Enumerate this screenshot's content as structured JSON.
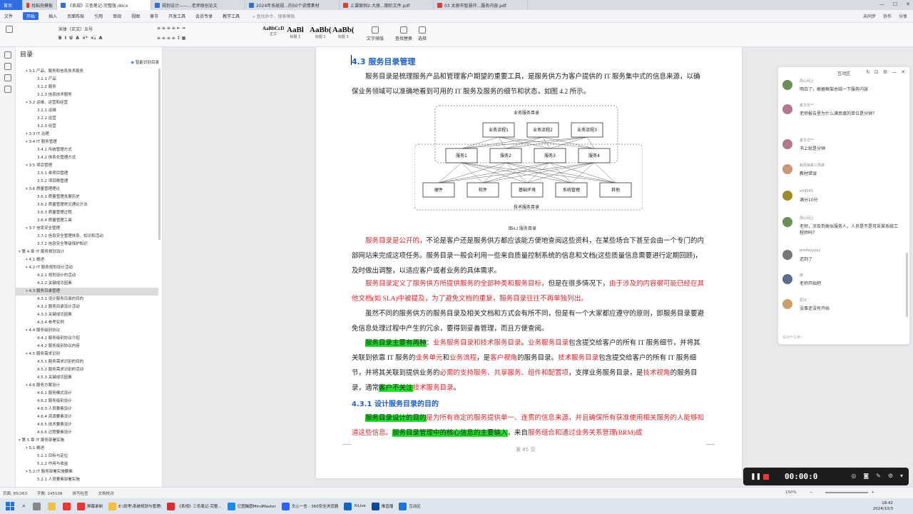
{
  "tabs": [
    {
      "label": "首页",
      "type": "home"
    },
    {
      "label": "找稻壳模板",
      "color": "#e53935"
    },
    {
      "label": "《系规》三色笔记-完整版.docx",
      "color": "#2f6fe0",
      "active": true
    },
    {
      "label": "规划设计——...老师原创论文",
      "color": "#2f6fe0"
    },
    {
      "label": "2024年系统规...的50个说情素材",
      "color": "#2f6fe0"
    },
    {
      "label": "上课案例2-大原...期阶文件.pdf",
      "color": "#e53935"
    },
    {
      "label": "03 太原市智慧环...服务内容.pdf",
      "color": "#e53935"
    }
  ],
  "menu": {
    "items": [
      "文件",
      "开始",
      "插入",
      "页面布局",
      "引用",
      "审阅",
      "视图",
      "章节",
      "开发工具",
      "会员专享",
      "教学工具"
    ],
    "active": "开始",
    "search_placeholder": "查找命令、搜索模板",
    "right": [
      "未同步",
      "协作",
      "分享"
    ]
  },
  "ribbon": {
    "font_name": "宋体（正文）",
    "font_size": "五号",
    "styles": [
      {
        "preview": "AaBbCcD",
        "label": "正文"
      },
      {
        "preview": "AaBl",
        "label": "标题 1"
      },
      {
        "preview": "AaBb(",
        "label": "标题 2"
      },
      {
        "preview": "AaBb(",
        "label": "标题 3"
      }
    ],
    "buttons": [
      "文字排版",
      "查找替换",
      "选择"
    ]
  },
  "toc": {
    "title": "目录",
    "smart_label": "智能识别目录",
    "selected_index": 32,
    "items": [
      {
        "text": "3.1 产品、服务和信息技术服务",
        "level": 1
      },
      {
        "text": "3.1.1 产品",
        "level": 2
      },
      {
        "text": "3.1.2 服务",
        "level": 2
      },
      {
        "text": "3.1.3 信息技术服务",
        "level": 2
      },
      {
        "text": "3.2 运维、运营和经营",
        "level": 1
      },
      {
        "text": "3.2.1 运维",
        "level": 2
      },
      {
        "text": "3.2.2 运营",
        "level": 2
      },
      {
        "text": "3.2.3 经营",
        "level": 2
      },
      {
        "text": "3.3 IT 治理",
        "level": 1
      },
      {
        "text": "3.4 IT 服务管理",
        "level": 1
      },
      {
        "text": "3.4.1 传统管理方式",
        "level": 2
      },
      {
        "text": "3.4.2 体系化管理方式",
        "level": 2
      },
      {
        "text": "3.5 项目管理",
        "level": 1
      },
      {
        "text": "3.5.1 单项目管理",
        "level": 2
      },
      {
        "text": "3.5.2 项目群管理",
        "level": 2
      },
      {
        "text": "3.6 质量管理理论",
        "level": 1
      },
      {
        "text": "3.6.1 质量管理发展历史",
        "level": 2
      },
      {
        "text": "3.6.2 质量管理常见理论方法",
        "level": 2
      },
      {
        "text": "3.6.3 质量管理过程",
        "level": 2
      },
      {
        "text": "3.6.4 质量管理工具",
        "level": 2
      },
      {
        "text": "3.7 信息安全管理",
        "level": 1
      },
      {
        "text": "3.7.1 信息安全管理体系、知识和活动",
        "level": 2
      },
      {
        "text": "3.7.2 信息安全等级保护知识",
        "level": 2
      },
      {
        "text": "第 4 章 IT 服务规划设计",
        "level": 0
      },
      {
        "text": "4.1 概述",
        "level": 1
      },
      {
        "text": "4.2 IT 服务规划设计活动",
        "level": 1
      },
      {
        "text": "4.2.1 规划设计的活动",
        "level": 2
      },
      {
        "text": "4.2.2 关键成功因素",
        "level": 2
      },
      {
        "text": "4.3 服务目录管理",
        "level": 1
      },
      {
        "text": "4.3.1 设计服务目录的目的",
        "level": 2
      },
      {
        "text": "4.3.2 服务目录设计活动",
        "level": 2
      },
      {
        "text": "4.3.3 关键成功因素",
        "level": 2
      },
      {
        "text": "4.3.4 参考实例",
        "level": 2
      },
      {
        "text": "4.4 服务级别协议",
        "level": 1
      },
      {
        "text": "4.4.1 服务级别协议介绍",
        "level": 2
      },
      {
        "text": "4.4.2 服务级别协议内容",
        "level": 2
      },
      {
        "text": "4.5 服务需求识别",
        "level": 1
      },
      {
        "text": "4.5.1 服务需求识别的目的",
        "level": 2
      },
      {
        "text": "4.5.2 服务需求识别的活动",
        "level": 2
      },
      {
        "text": "4.5.3 关键成功因素",
        "level": 2
      },
      {
        "text": "4.6 服务方案设计",
        "level": 1
      },
      {
        "text": "4.6.1 服务模式设计",
        "level": 2
      },
      {
        "text": "4.6.2 服务级别设计",
        "level": 2
      },
      {
        "text": "4.6.3 人员要素设计",
        "level": 2
      },
      {
        "text": "4.6.4 资源要素设计",
        "level": 2
      },
      {
        "text": "4.6.5 技术要素设计",
        "level": 2
      },
      {
        "text": "4.6.6 过程要素设计",
        "level": 2
      },
      {
        "text": "第 5 章 IT 服务部署实施",
        "level": 0
      },
      {
        "text": "5.1 概述",
        "level": 1
      },
      {
        "text": "5.1.1 目标与定位",
        "level": 2
      },
      {
        "text": "5.1.2 作用与收益",
        "level": 2
      },
      {
        "text": "5.2 IT 服务部署实施要素",
        "level": 1
      },
      {
        "text": "5.2.1 人员要素部署实施",
        "level": 2
      }
    ]
  },
  "document": {
    "heading": "4.3  服务目录管理",
    "para1": "服务目录是梳理服务产品和管理客户期望的重要工具，是服务供方为客户提供的 IT 服务集中式的信息来源，以确保业务领域可以准确地看到可用的 IT 服务及服务的细节和状态，如图 4.2 所示。",
    "diagram": {
      "top_label": "业务服务目录",
      "bottom_label": "技术服务目录",
      "processes": [
        "业务流程1",
        "业务流程2",
        "业务流程3"
      ],
      "services": [
        "服务1",
        "服务2",
        "服务3",
        "服务4"
      ],
      "components": [
        "硬件",
        "软件",
        "基础环境",
        "系统管理",
        "其他"
      ]
    },
    "figure_caption": "图4.2   服务目录",
    "para2_red": "服务目录是公开的，",
    "para2": "不论是客户还是服务供方都应该能方便地查阅这些资料，在某些场合下甚至会由一个专门的内部网站来完成这项任务。服务目录一般会利用一些来自质量控制系统的信息和文档(这些质量信息需要进行定期回顾)，及时做出调整，以适应客户或者业务的具体需求。",
    "para3_a": "服务目录定义了服务供方所提供服务的全部种类和服务目标，",
    "para3_b": "但是在很多情况下，",
    "para3_c": "由于涉及的内容很可能已经在其他文档(如 SLA)中被提及，为了避免文档的重复，服务目录往往不再单独列出。",
    "para4": "虽然不同的服务供方的服务目录及相关文档和方式会有所不同，但是有一个大家都应遵守的原则，即服务目录要避免信息处理过程中产生的冗余，要得到妥善管理，而且方便查阅。",
    "para5": [
      {
        "t": "服务目录主要有两种",
        "s": "hl"
      },
      {
        "t": "：",
        "s": ""
      },
      {
        "t": "业务服务目录和技术服务目录",
        "s": "red"
      },
      {
        "t": "。",
        "s": ""
      },
      {
        "t": "业务服务目录",
        "s": "red"
      },
      {
        "t": "包含提交给客户的所有 IT 服务细节，并将其关联到依靠 IT 服务的",
        "s": ""
      },
      {
        "t": "业务单元",
        "s": "red"
      },
      {
        "t": "和",
        "s": ""
      },
      {
        "t": "业务流程",
        "s": "red"
      },
      {
        "t": "，是",
        "s": ""
      },
      {
        "t": "客户视角",
        "s": "red"
      },
      {
        "t": "的服务目录。",
        "s": ""
      },
      {
        "t": "技术服务目录",
        "s": "red"
      },
      {
        "t": "包含提交给客户的所有 IT 服务细节，并将其关联到提供业务的",
        "s": ""
      },
      {
        "t": "必需的支持服务、共享服务、组件和配置项",
        "s": "red"
      },
      {
        "t": "，支撑业务服务目录，是",
        "s": ""
      },
      {
        "t": "技术视角",
        "s": "red"
      },
      {
        "t": "的服务目录，通常",
        "s": ""
      },
      {
        "t": "客户不关注",
        "s": "hl"
      },
      {
        "t": "技术服务目录",
        "s": "red"
      },
      {
        "t": "。",
        "s": ""
      }
    ],
    "subheading": "4.3.1  设计服务目录的目的",
    "para6": [
      {
        "t": "服务目录设计的目的",
        "s": "hl"
      },
      {
        "t": "是为所有商定的服务提供单一、连贯的信息来源，并且确保所有获准使用相关服务的人能够知道这些信息。",
        "s": "red"
      },
      {
        "t": "服务目录管理中的核心信息的主要输入",
        "s": "hl"
      },
      {
        "t": "，来自",
        "s": ""
      },
      {
        "t": "服务组合和通过业务关系管理(BRM)或",
        "s": "red"
      }
    ],
    "page_footer": "第  85  页"
  },
  "chat": {
    "title": "互动区",
    "input_placeholder": "说点什么吧~",
    "messages": [
      {
        "name": "周心间上",
        "text": "明白了，根据框架总结一下服务内容",
        "color": "#6b8e5a"
      },
      {
        "name": "夏华华**",
        "text": "老师报告里为什么满意度的单位是分钟？",
        "color": "#b07a8c"
      },
      {
        "name": "夏华华**",
        "text": "书上就是分钟",
        "color": "#b07a8c"
      },
      {
        "name": "和风徐来三周讲",
        "text": "教材错误",
        "color": "#c9967a"
      },
      {
        "name": "a54545",
        "text": "满分10分",
        "color": "#9a8a2a"
      },
      {
        "name": "周心间上",
        "text": "老师，涉及到类似服务人，人员是不是可采某系统工程师吗？",
        "color": "#6b8e5a"
      },
      {
        "name": "predayyyyy",
        "text": "迟到了",
        "color": "#777777"
      },
      {
        "name": "寂",
        "text": "老师开始吧",
        "color": "#5a6e8a"
      },
      {
        "name": "原仔",
        "text": "没事还没有开始",
        "color": "#c9a06a"
      }
    ]
  },
  "recorder": {
    "time": "00:00:0"
  },
  "status": {
    "page": "页面: 85/263",
    "words": "字数: 245108",
    "spell": "拼写检查",
    "proof": "文档校对",
    "zoom": "150%"
  },
  "taskbar": {
    "apps": [
      "屏幕录制",
      "E:\\软考\\系统规划与管理\\",
      "《系规》三色笔记-完整...",
      "亿图脑图MindMaster",
      "文心一言 - 360安全浏览器",
      "XiLive",
      "推直播",
      "互动区"
    ],
    "time": "18:42",
    "date": "2024/10/3"
  }
}
